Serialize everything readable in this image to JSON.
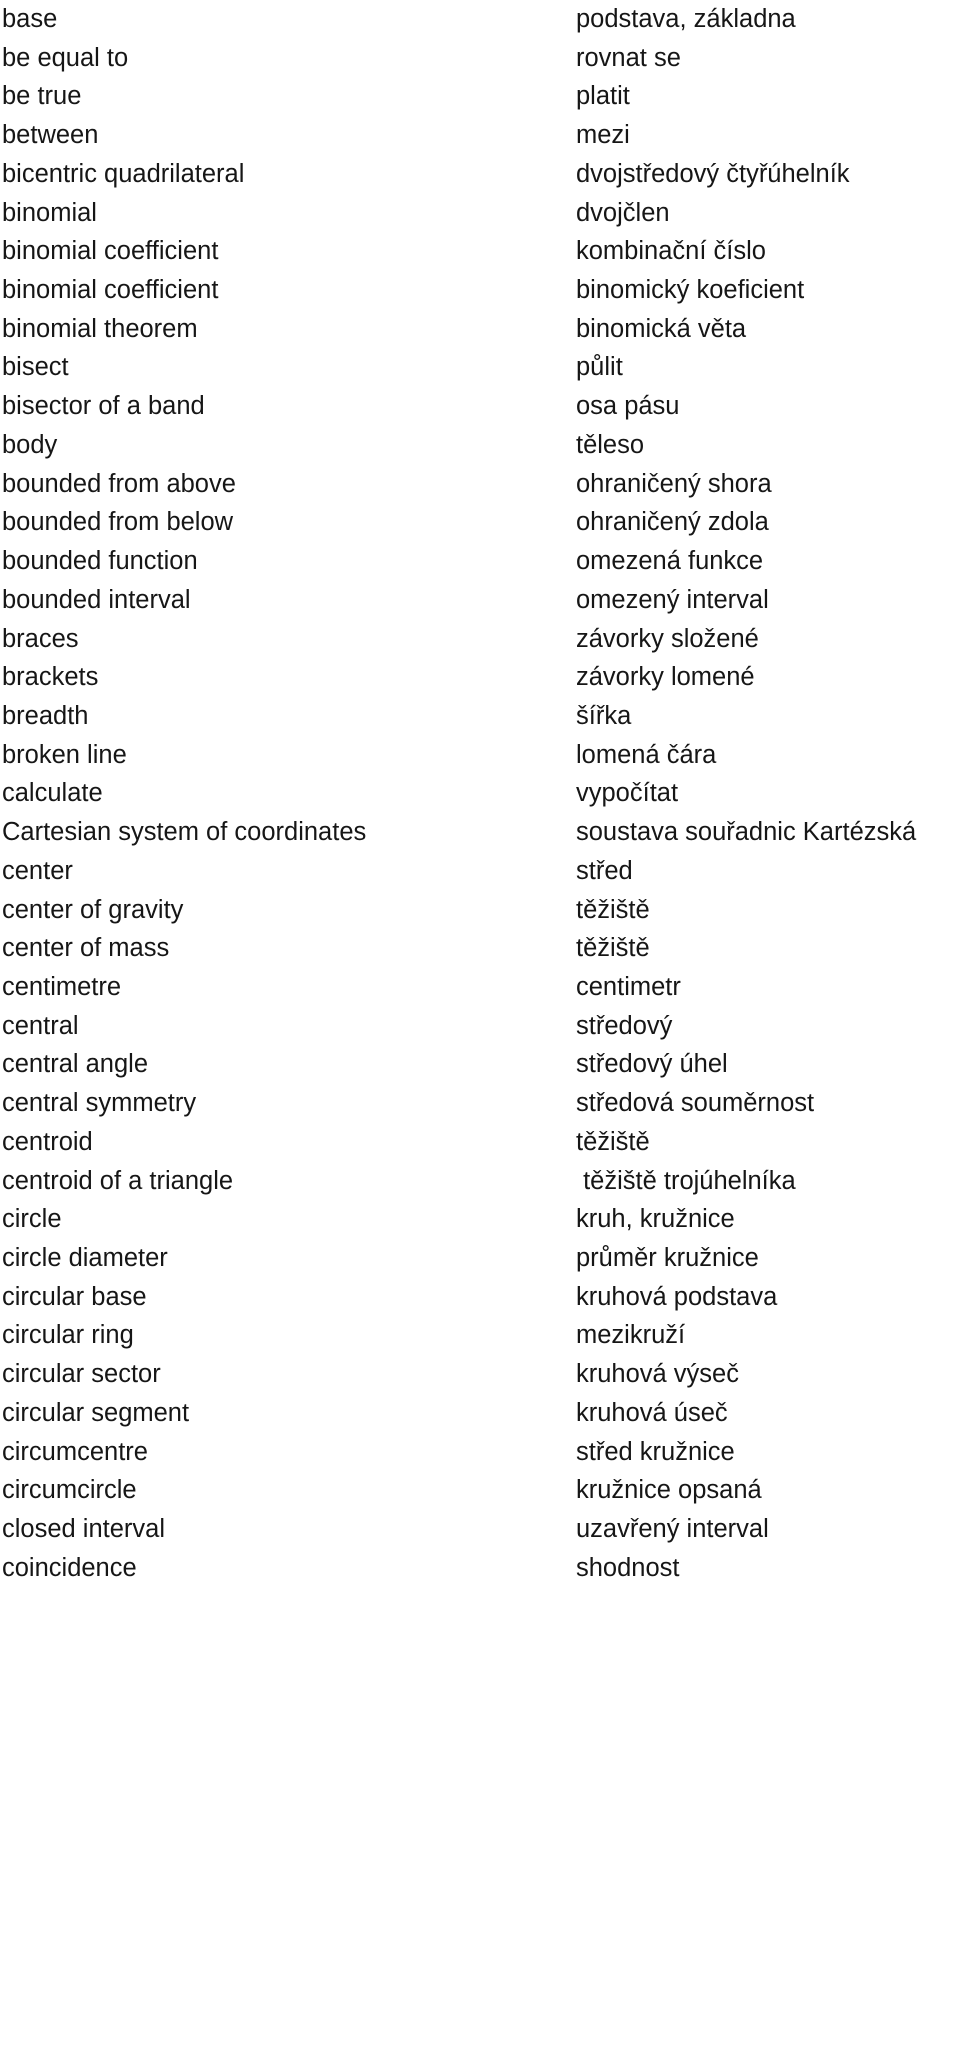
{
  "document": {
    "type": "bilingual-glossary",
    "source_language_column": "English",
    "target_language_column": "Czech",
    "entries": [
      {
        "term": "base",
        "translation": "podstava, základna"
      },
      {
        "term": "be equal to",
        "translation": "rovnat se"
      },
      {
        "term": "be true",
        "translation": "platit"
      },
      {
        "term": "between",
        "translation": "mezi"
      },
      {
        "term": "bicentric quadrilateral",
        "translation": "dvojstředový čtyřúhelník"
      },
      {
        "term": "binomial",
        "translation": "dvojčlen"
      },
      {
        "term": "binomial coefficient",
        "translation": "kombinační číslo"
      },
      {
        "term": "binomial coefficient",
        "translation": "binomický koeficient"
      },
      {
        "term": "binomial theorem",
        "translation": "binomická věta"
      },
      {
        "term": "bisect",
        "translation": "půlit"
      },
      {
        "term": "bisector of a band",
        "translation": "osa pásu"
      },
      {
        "term": "body",
        "translation": "těleso"
      },
      {
        "term": "bounded from above",
        "translation": "ohraničený shora"
      },
      {
        "term": "bounded from below",
        "translation": "ohraničený zdola"
      },
      {
        "term": "bounded function",
        "translation": "omezená funkce"
      },
      {
        "term": "bounded interval",
        "translation": "omezený interval"
      },
      {
        "term": "braces",
        "translation": "závorky složené"
      },
      {
        "term": "brackets",
        "translation": "závorky lomené"
      },
      {
        "term": "breadth",
        "translation": "šířka"
      },
      {
        "term": "broken line",
        "translation": "lomená čára"
      },
      {
        "term": "calculate",
        "translation": "vypočítat"
      },
      {
        "term": "Cartesian system of coordinates",
        "translation": "soustava souřadnic Kartézská"
      },
      {
        "term": "center",
        "translation": "střed"
      },
      {
        "term": "center of gravity",
        "translation": "těžiště"
      },
      {
        "term": "center of mass",
        "translation": "těžiště"
      },
      {
        "term": "centimetre",
        "translation": "centimetr"
      },
      {
        "term": "central",
        "translation": "středový"
      },
      {
        "term": "central angle",
        "translation": "středový úhel"
      },
      {
        "term": "central symmetry",
        "translation": "středová souměrnost"
      },
      {
        "term": "centroid",
        "translation": "těžiště"
      },
      {
        "term": "centroid of a triangle",
        "translation": " těžiště trojúhelníka"
      },
      {
        "term": "circle",
        "translation": "kruh, kružnice"
      },
      {
        "term": "circle diameter",
        "translation": "průměr kružnice"
      },
      {
        "term": "circular base",
        "translation": "kruhová podstava"
      },
      {
        "term": "circular ring",
        "translation": "mezikruží"
      },
      {
        "term": "circular sector",
        "translation": "kruhová výseč"
      },
      {
        "term": "circular segment",
        "translation": "kruhová úseč"
      },
      {
        "term": "circumcentre",
        "translation": "střed kružnice"
      },
      {
        "term": "circumcircle",
        "translation": "kružnice opsaná"
      },
      {
        "term": "closed interval",
        "translation": "uzavřený interval"
      },
      {
        "term": "coincidence",
        "translation": "shodnost"
      }
    ]
  },
  "colors": {
    "page_background": "#ffffff",
    "text": "#161616"
  }
}
